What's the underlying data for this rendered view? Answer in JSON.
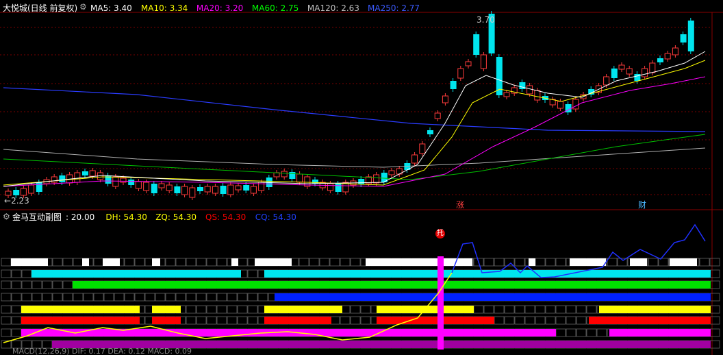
{
  "main_panel": {
    "title": "大悦城(日线 前复权)",
    "indicators": [
      {
        "label": "MA5: 3.40",
        "color": "#ffffff"
      },
      {
        "label": "MA10: 3.34",
        "color": "#ffff00"
      },
      {
        "label": "MA20: 3.20",
        "color": "#ff00ff"
      },
      {
        "label": "MA60: 2.75",
        "color": "#00ff00"
      },
      {
        "label": "MA120: 2.63",
        "color": "#c0c0c0"
      },
      {
        "label": "MA250: 2.77",
        "color": "#3b5bff"
      }
    ],
    "high_label": "3.70",
    "low_label": "2.23",
    "markers": [
      {
        "text": "涨",
        "color": "#ff4040"
      },
      {
        "text": "财",
        "color": "#4db8ff"
      }
    ]
  },
  "sub_panel": {
    "title": "金马互动副图",
    "params": [
      {
        "label": ": 20.00",
        "color": "#ffffff"
      },
      {
        "label": "DH: 54.30",
        "color": "#ffff00"
      },
      {
        "label": "ZQ: 54.30",
        "color": "#ffff00"
      },
      {
        "label": "QS: 54.30",
        "color": "#ff0000"
      },
      {
        "label": "CQ: 54.30",
        "color": "#2040ff"
      }
    ],
    "badge": "托"
  },
  "bottom_panel": {
    "label": "MACD(12,26,9)  DIF: 0.17  DEA: 0.12  MACD: 0.09"
  },
  "colors": {
    "up": "#ff3b3b",
    "down": "#00e5ee",
    "grid": "#7a0000"
  }
}
